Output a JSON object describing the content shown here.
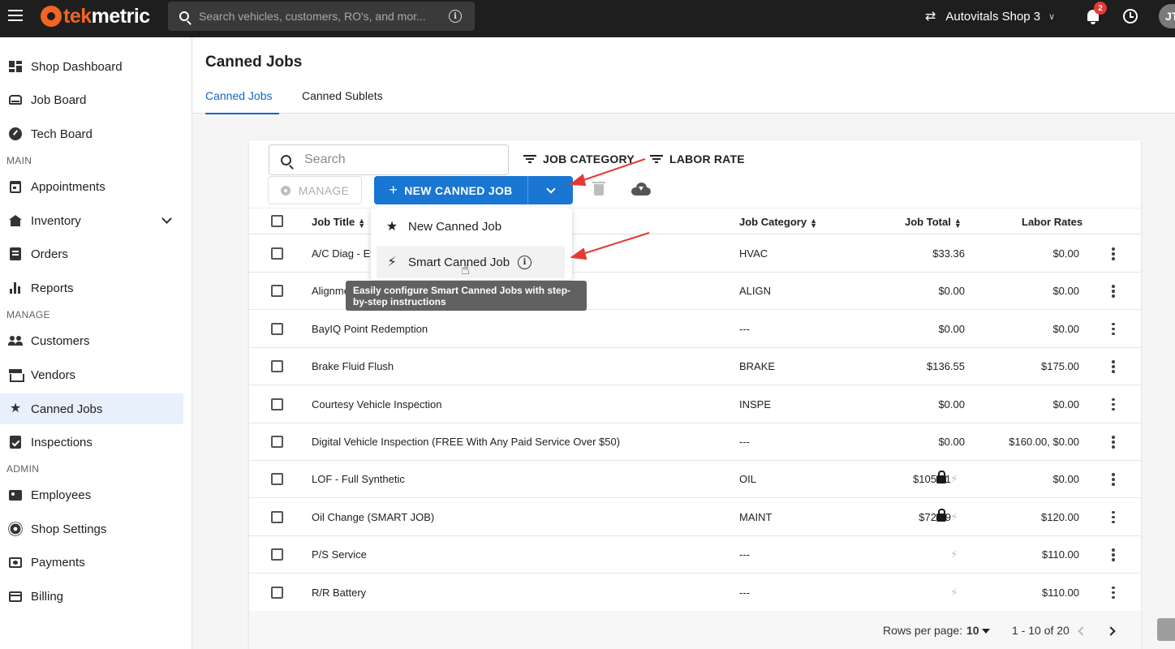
{
  "topbar": {
    "logo_part1": "tek",
    "logo_part2": "metric",
    "search_placeholder": "Search vehicles, customers, RO's, and mor...",
    "shop_name": "Autovitals Shop 3",
    "notification_count": "2",
    "user_initials": "JT"
  },
  "sidebar": {
    "items_top": [
      {
        "label": "Shop Dashboard",
        "icon": "dashboard-icon"
      },
      {
        "label": "Job Board",
        "icon": "car-icon"
      },
      {
        "label": "Tech Board",
        "icon": "gauge-icon"
      }
    ],
    "section_main": "MAIN",
    "items_main": [
      {
        "label": "Appointments",
        "icon": "calendar-icon"
      },
      {
        "label": "Inventory",
        "icon": "warehouse-icon"
      },
      {
        "label": "Orders",
        "icon": "list-icon"
      },
      {
        "label": "Reports",
        "icon": "bar-chart-icon"
      }
    ],
    "section_manage": "MANAGE",
    "items_manage": [
      {
        "label": "Customers",
        "icon": "people-icon"
      },
      {
        "label": "Vendors",
        "icon": "store-icon"
      },
      {
        "label": "Canned Jobs",
        "icon": "star-icon"
      },
      {
        "label": "Inspections",
        "icon": "clipboard-check-icon"
      }
    ],
    "section_admin": "ADMIN",
    "items_admin": [
      {
        "label": "Employees",
        "icon": "badge-icon"
      },
      {
        "label": "Shop Settings",
        "icon": "gear-icon"
      },
      {
        "label": "Payments",
        "icon": "payments-icon"
      },
      {
        "label": "Billing",
        "icon": "credit-card-icon"
      }
    ]
  },
  "page": {
    "title": "Canned Jobs",
    "tabs": [
      {
        "label": "Canned Jobs",
        "active": true
      },
      {
        "label": "Canned Sublets",
        "active": false
      }
    ]
  },
  "toolbar": {
    "search_placeholder": "Search",
    "filter_job_category": "JOB CATEGORY",
    "filter_labor_rate": "LABOR RATE",
    "manage_label": "MANAGE",
    "new_button_label": "NEW CANNED JOB"
  },
  "dropdown": {
    "items": [
      {
        "label": "New Canned Job",
        "icon": "star-icon"
      },
      {
        "label": "Smart Canned Job",
        "icon": "bolt-icon"
      }
    ],
    "tooltip": "Easily configure Smart Canned Jobs with step-by-step instructions"
  },
  "table": {
    "columns": {
      "job_title": "Job Title",
      "job_category": "Job Category",
      "job_total": "Job Total",
      "labor_rates": "Labor Rates"
    },
    "rows": [
      {
        "title": "A/C Diag - Ev",
        "category": "HVAC",
        "total": "$33.36",
        "locked": false,
        "smart": false,
        "labor": "$0.00"
      },
      {
        "title": "Alignme",
        "category": "ALIGN",
        "total": "$0.00",
        "locked": false,
        "smart": false,
        "labor": "$0.00"
      },
      {
        "title": "BayIQ Point Redemption",
        "category": "---",
        "total": "$0.00",
        "locked": false,
        "smart": false,
        "labor": "$0.00"
      },
      {
        "title": "Brake Fluid Flush",
        "category": "BRAKE",
        "total": "$136.55",
        "locked": false,
        "smart": false,
        "labor": "$175.00"
      },
      {
        "title": "Courtesy Vehicle Inspection",
        "category": "INSPE",
        "total": "$0.00",
        "locked": false,
        "smart": false,
        "labor": "$0.00"
      },
      {
        "title": "Digital Vehicle Inspection (FREE With Any Paid Service Over $50)",
        "category": "---",
        "total": "$0.00",
        "locked": false,
        "smart": false,
        "labor": "$160.00, $0.00"
      },
      {
        "title": "LOF - Full Synthetic",
        "category": "OIL",
        "total": "$105.01",
        "locked": true,
        "smart": true,
        "labor": "$0.00"
      },
      {
        "title": "Oil Change (SMART JOB)",
        "category": "MAINT",
        "total": "$72.99",
        "locked": true,
        "smart": true,
        "labor": "$120.00"
      },
      {
        "title": "P/S Service",
        "category": "---",
        "total": "",
        "locked": false,
        "smart": true,
        "labor": "$110.00"
      },
      {
        "title": "R/R Battery",
        "category": "---",
        "total": "",
        "locked": false,
        "smart": true,
        "labor": "$110.00"
      }
    ]
  },
  "pagination": {
    "rows_per_page_label": "Rows per page:",
    "rows_per_page": "10",
    "range": "1 - 10 of 20"
  },
  "colors": {
    "brand_orange": "#f26522",
    "primary_blue": "#1976d2",
    "annotation_red": "#e53935"
  }
}
